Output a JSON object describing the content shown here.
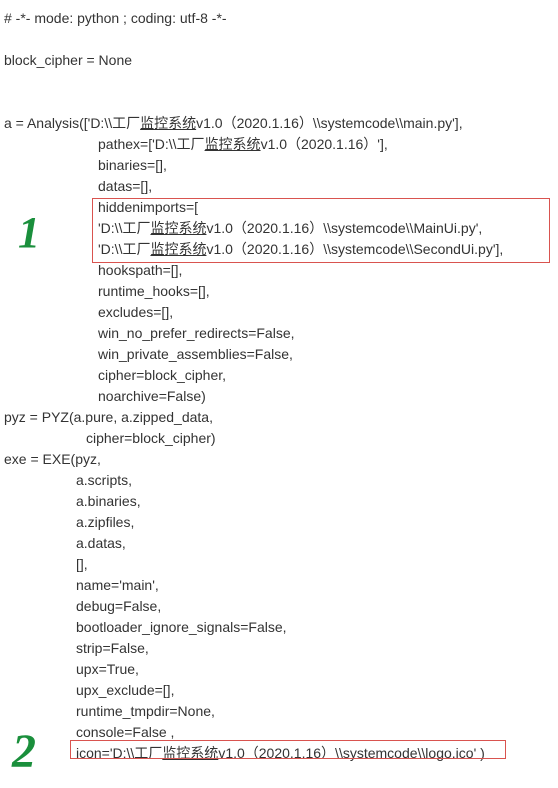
{
  "lines": {
    "l0": "# -*- mode: python ; coding: utf-8 -*-",
    "l1": "block_cipher = None",
    "l2_a": "a = Analysis(['D:\\\\工厂",
    "l2_b": "监控系统",
    "l2_c": "v1.0（2020.1.16）\\\\systemcode\\\\main.py'],",
    "l3_a": "pathex=['D:\\\\工厂",
    "l3_b": "监控系统",
    "l3_c": "v1.0（2020.1.16）'],",
    "l4": "binaries=[],",
    "l5": "datas=[],",
    "l6": "hiddenimports=[",
    "l7_a": "'D:\\\\工厂",
    "l7_b": "监控系统",
    "l7_c": "v1.0（2020.1.16）\\\\systemcode\\\\MainUi.py',",
    "l8_a": "'D:\\\\工厂",
    "l8_b": "监控系统",
    "l8_c": "v1.0（2020.1.16）\\\\systemcode\\\\SecondUi.py'],",
    "l9": "hookspath=[],",
    "l10": "runtime_hooks=[],",
    "l11": "excludes=[],",
    "l12": "win_no_prefer_redirects=False,",
    "l13": "win_private_assemblies=False,",
    "l14": "cipher=block_cipher,",
    "l15": "noarchive=False)",
    "l16": "pyz = PYZ(a.pure, a.zipped_data,",
    "l17": "cipher=block_cipher)",
    "l18": "exe = EXE(pyz,",
    "l19": "a.scripts,",
    "l20": "a.binaries,",
    "l21": "a.zipfiles,",
    "l22": "a.datas,",
    "l23": "[],",
    "l24": "name='main',",
    "l25": "debug=False,",
    "l26": "bootloader_ignore_signals=False,",
    "l27": "strip=False,",
    "l28": "upx=True,",
    "l29": "upx_exclude=[],",
    "l30": "runtime_tmpdir=None,",
    "l31": "console=False ,",
    "l32_a": "icon='D:\\\\工厂",
    "l32_b": "监控系统",
    "l32_c": "v1.0（2020.1.16）\\\\systemcode\\\\logo.ico' )"
  },
  "annotations": {
    "one": "1",
    "two": "2"
  }
}
